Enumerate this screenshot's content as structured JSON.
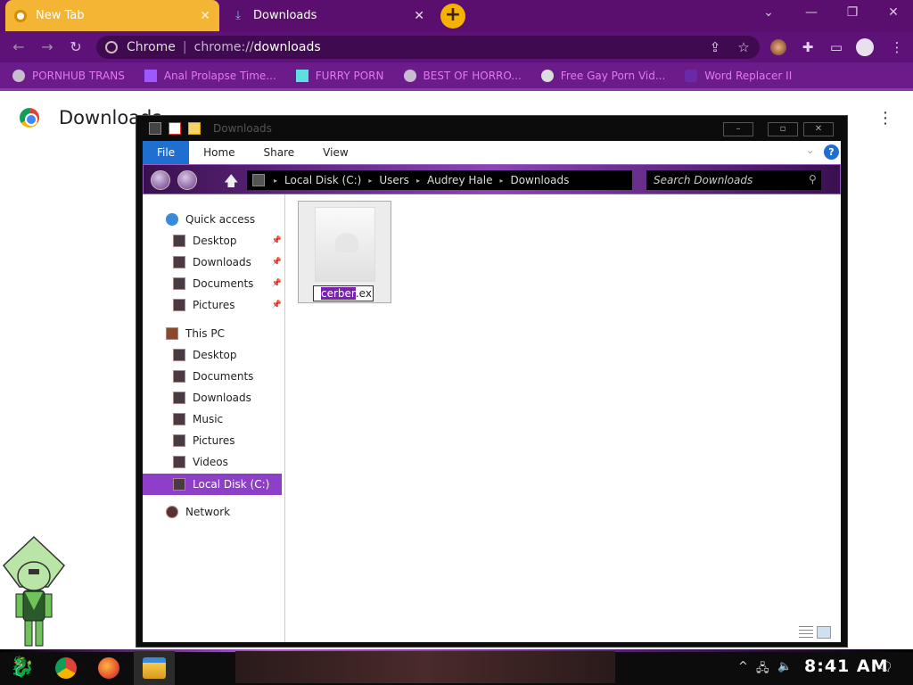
{
  "browser": {
    "tabs": [
      {
        "title": "New Tab",
        "close": "✕"
      },
      {
        "title": "Downloads",
        "close": "✕"
      }
    ],
    "new_tab": "+",
    "window_controls": {
      "tab_search": "⌄",
      "minimize": "—",
      "restore": "❐",
      "close": "✕"
    },
    "nav": {
      "back": "←",
      "forward": "→",
      "reload": "↻"
    },
    "omnibox": {
      "label": "Chrome",
      "separator": "|",
      "host": "chrome://",
      "path": "downloads"
    },
    "toolbar_icons": {
      "share": "⇪",
      "bookmark_star": "☆",
      "extensions": "✚",
      "side_panel": "▭",
      "menu": "⋮"
    },
    "bookmarks": [
      {
        "label": "PORNHUB TRANS"
      },
      {
        "label": "Anal Prolapse Time..."
      },
      {
        "label": "FURRY PORN"
      },
      {
        "label": "BEST OF HORRO..."
      },
      {
        "label": "Free Gay Porn Vid..."
      },
      {
        "label": "Word Replacer II"
      }
    ]
  },
  "page": {
    "title": "Downloads",
    "menu": "⋮"
  },
  "explorer": {
    "title": "Downloads",
    "controls": {
      "minimize": "–",
      "maximize": "▫",
      "close": "✕"
    },
    "ribbon": [
      "File",
      "Home",
      "Share",
      "View"
    ],
    "ribbon_chevron": "⌄",
    "help": "?",
    "up": "🡅",
    "breadcrumbs": [
      "Local Disk (C:)",
      "Users",
      "Audrey Hale",
      "Downloads"
    ],
    "crumb_sep": "▸",
    "search_placeholder": "Search Downloads",
    "search_glyph": "⚲",
    "nav": {
      "quick_access": "Quick access",
      "quick_items": [
        "Desktop",
        "Downloads",
        "Documents",
        "Pictures"
      ],
      "pin": "📌",
      "this_pc": "This PC",
      "pc_items": [
        "Desktop",
        "Documents",
        "Downloads",
        "Music",
        "Pictures",
        "Videos"
      ],
      "local_disk": "Local Disk (C:)",
      "network": "Network"
    },
    "file": {
      "name_selected": "cerber",
      "name_rest": ".ex"
    }
  },
  "taskbar": {
    "start": "🐉",
    "tray": {
      "chevron": "^",
      "network": "🖧",
      "volume": "🔈"
    },
    "clock": "8:41 AM",
    "notifications": "🗨"
  },
  "colors": {
    "tabstrip": "#5a0f6e",
    "accent": "#f5b200",
    "bookmark_text": "#e079f0",
    "selection": "#8e3fc8"
  }
}
